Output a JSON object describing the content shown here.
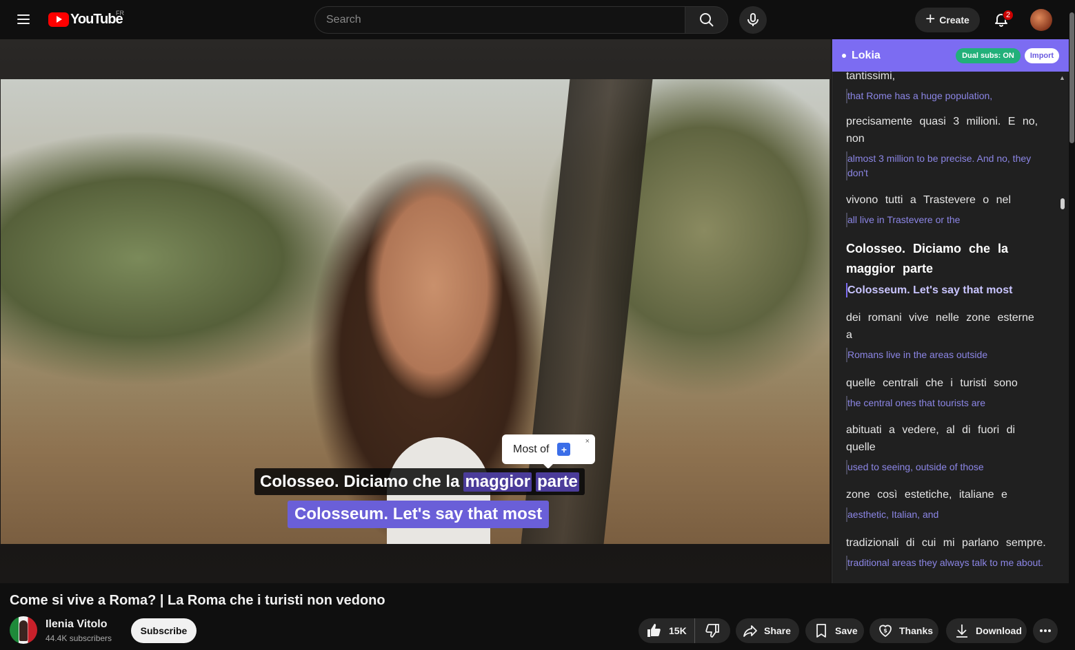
{
  "header": {
    "logo_text": "YouTube",
    "region": "FR",
    "search_placeholder": "Search",
    "create_label": "Create",
    "notification_count": "2"
  },
  "player": {
    "subtitle_primary": {
      "before": "Colosseo. Diciamo che la",
      "hl1": "maggior",
      "hl2": "parte"
    },
    "subtitle_secondary": "Colosseum. Let's say that most",
    "tooltip": {
      "text": "Most of",
      "add": "+",
      "close": "×"
    }
  },
  "panel": {
    "title": "Lokia",
    "dual_subs": "Dual subs: ON",
    "import": "Import",
    "segments": [
      {
        "orig": "tantissimi,",
        "trans": "that Rome has a huge population,"
      },
      {
        "orig": "precisamente quasi 3 milioni. E no, non",
        "trans": "almost 3 million to be precise. And no, they don't"
      },
      {
        "orig": "vivono tutti a Trastevere o nel",
        "trans": "all live in Trastevere or the"
      },
      {
        "orig": "Colosseo. Diciamo che la maggior parte",
        "trans": "Colosseum. Let's say that most",
        "active": true
      },
      {
        "orig": "dei romani vive nelle zone esterne a",
        "trans": "Romans live in the areas outside"
      },
      {
        "orig": "quelle centrali che i turisti sono",
        "trans": "the central ones that tourists are"
      },
      {
        "orig": "abituati a vedere, al di fuori di quelle",
        "trans": "used to seeing, outside of those"
      },
      {
        "orig": "zone così estetiche, italiane e",
        "trans": "aesthetic, Italian, and"
      },
      {
        "orig": "tradizionali di cui mi parlano sempre.",
        "trans": "traditional areas they always talk to me about."
      }
    ]
  },
  "video": {
    "title": "Come si vive a Roma? | La Roma che i turisti non vedono",
    "channel_name": "Ilenia Vitolo",
    "channel_subs": "44.4K subscribers",
    "subscribe": "Subscribe",
    "likes": "15K",
    "share": "Share",
    "save": "Save",
    "thanks": "Thanks",
    "download": "Download"
  },
  "colors": {
    "accent": "#7c6cf2",
    "dual_on": "#22b07a",
    "translation_text": "#8c86e6",
    "youtube_red": "#ff0000"
  }
}
